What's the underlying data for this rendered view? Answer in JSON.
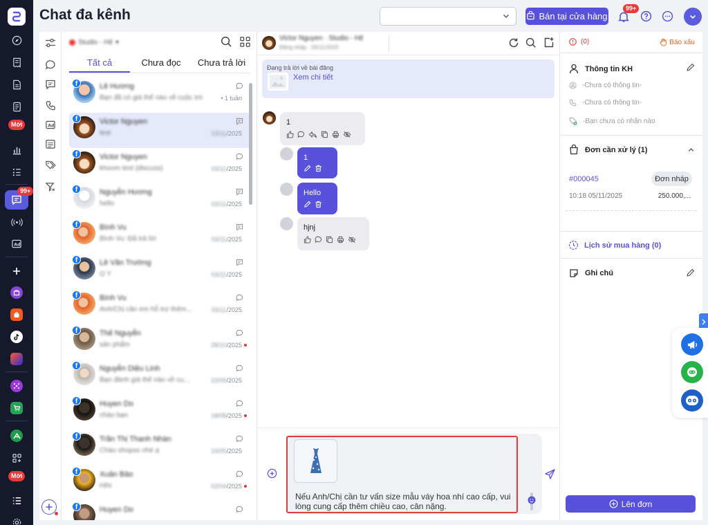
{
  "header": {
    "title": "Chat đa kênh",
    "store_select_value": "",
    "sell_button": "Bán tại cửa hàng",
    "notification_badge": "99+"
  },
  "rail": {
    "new_label": "Mới",
    "new_label_2": "Mới",
    "chat_badge": "99+"
  },
  "conversations": {
    "page_filter": "Studio - Hệ",
    "tabs": [
      "Tất cả",
      "Chưa đọc",
      "Chưa trả lời"
    ],
    "items": [
      {
        "name": "Lê Hương",
        "preview": "Bạn đã có giá thế nào về cuộc trò",
        "date": "1 tuần",
        "date_blur": false,
        "unread": false,
        "icon": "message-circle-icon"
      },
      {
        "name": "Victor Nguyen",
        "preview": "test",
        "date": "03/11/2025",
        "date_blur": true,
        "unread": false,
        "icon": "message-square-icon"
      },
      {
        "name": "Victor Nguyen",
        "preview": "khoom test (discuss)",
        "date": "03/11/2025",
        "date_blur": true,
        "unread": false,
        "icon": "message-circle-icon"
      },
      {
        "name": "Nguyễn Hương",
        "preview": "hello",
        "date": "03/11/2025",
        "date_blur": true,
        "unread": false,
        "icon": "message-square-icon"
      },
      {
        "name": "Bình Vu",
        "preview": "Bình Vu: Đã trả lời",
        "date": "03/11/2025",
        "date_blur": true,
        "unread": false,
        "icon": "message-square-icon"
      },
      {
        "name": "Lê Văn Trường",
        "preview": "O Y",
        "date": "03/11/2025",
        "date_blur": true,
        "unread": false,
        "icon": "message-square-icon"
      },
      {
        "name": "Bình Vu",
        "preview": "Anh/Chị cần em hỗ trợ thêm...",
        "date": "03/11/2025",
        "date_blur": true,
        "unread": false,
        "icon": "message-circle-icon"
      },
      {
        "name": "Thế Nguyễn",
        "preview": "sản phẩm",
        "date": "28/10/2025",
        "date_blur": true,
        "unread": true,
        "icon": "message-circle-icon"
      },
      {
        "name": "Nguyễn Diệu Linh",
        "preview": "Bạn đánh giá thế nào về cu...",
        "date": "22/09/2025",
        "date_blur": true,
        "unread": false,
        "icon": "message-circle-icon"
      },
      {
        "name": "Huyen Do",
        "preview": "chào bạn",
        "date": "18/08/2025",
        "date_blur": true,
        "unread": true,
        "icon": "message-circle-icon"
      },
      {
        "name": "Trần Thị Thanh Nhàn",
        "preview": "Chào shopss nhé ạ",
        "date": "15/05/2025",
        "date_blur": true,
        "unread": false,
        "icon": "message-circle-icon"
      },
      {
        "name": "Xuân Bảo",
        "preview": "Hihi",
        "date": "02/04/2025",
        "date_blur": true,
        "unread": true,
        "icon": "message-circle-icon"
      },
      {
        "name": "Huyen Do",
        "preview": "",
        "date": "",
        "date_blur": true,
        "unread": false,
        "icon": "message-circle-icon"
      }
    ]
  },
  "chat": {
    "contact_name": "Victor Nguyen",
    "contact_sub": "Đăng nhập · 05/11/2025",
    "contact_channel": "Studio - Hệ",
    "reply_context_label": "Đang trả lời về bài đăng",
    "reply_context_link": "Xem chi tiết",
    "messages": [
      {
        "dir": "in",
        "text": "1"
      },
      {
        "dir": "out",
        "text": "1"
      },
      {
        "dir": "out",
        "text": "Hello"
      },
      {
        "dir": "in",
        "text": "hjnj"
      }
    ],
    "composer_text": "Nếu Anh/Chị cần tư vấn size mẫu váy hoa nhí cao cấp, vui lòng cung cấp thêm chiều cao, cân nặng."
  },
  "customer_panel": {
    "warning_count": "(0)",
    "report_label": "Báo xấu",
    "info_title": "Thông tin KH",
    "name_placeholder": "-Chưa có thông tin-",
    "phone_placeholder": "-Chưa có thông tin-",
    "tag_placeholder": "-Bạn chưa có nhãn nào",
    "orders_title": "Đơn cần xử lý (1)",
    "order": {
      "id": "#000045",
      "status": "Đơn nháp",
      "time": "10:18 05/11/2025",
      "amount": "250.000,..."
    },
    "history_title": "Lịch sử mua hàng (0)",
    "notes_title": "Ghi chú",
    "create_order_button": "Lên đơn"
  },
  "colors": {
    "accent": "#5851db",
    "rail_bg": "#15192b",
    "danger": "#e93a3a",
    "warning": "#e8661a"
  }
}
